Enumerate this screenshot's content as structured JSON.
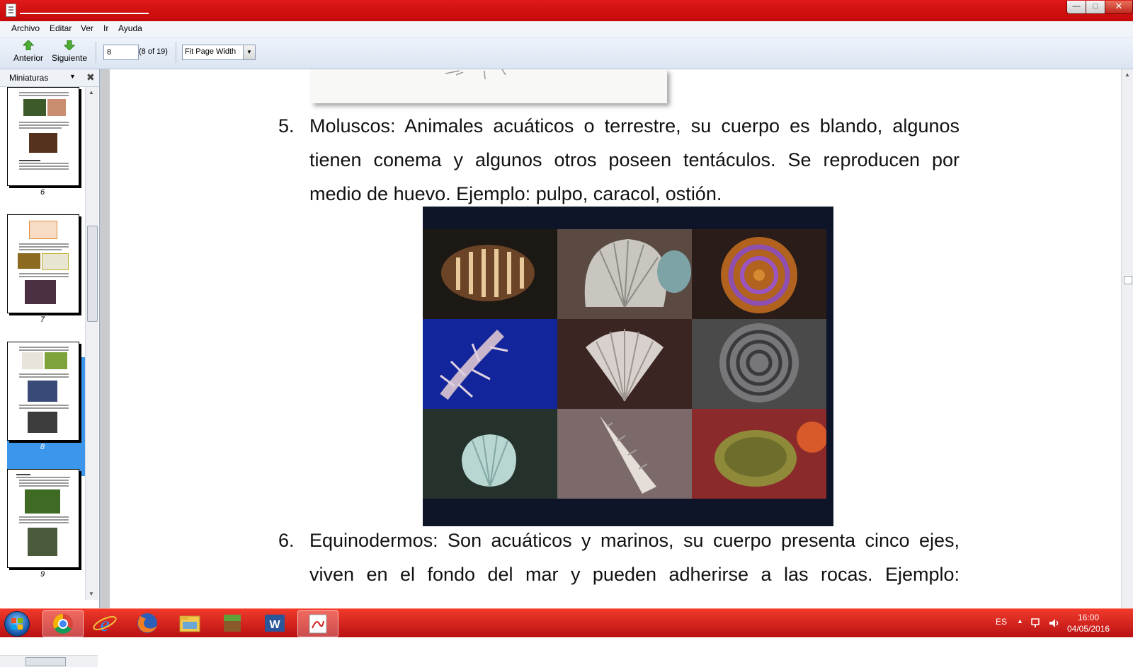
{
  "window": {
    "title": "",
    "min": "—",
    "max": "□",
    "close": "✕"
  },
  "menu": [
    "Archivo",
    "Editar",
    "Ver",
    "Ir",
    "Ayuda"
  ],
  "toolbar": {
    "prev_label": "Anterior",
    "next_label": "Siguiente",
    "page_value": "8",
    "page_count": "(8 of 19)",
    "zoom_value": "Fit Page Width",
    "zoom_dropdown_icon": "▼"
  },
  "sidebar": {
    "title": "Miniaturas",
    "dropdown_icon": "▼",
    "close_icon": "✖",
    "thumbnails": [
      {
        "label": "6"
      },
      {
        "label": "7"
      },
      {
        "label": "8",
        "selected": true
      },
      {
        "label": "9"
      }
    ]
  },
  "document": {
    "items": [
      {
        "number": "5.",
        "lines": [
          "Moluscos: Animales acuáticos o terrestre, su cuerpo es blando, algunos",
          "tienen conema y algunos otros poseen tentáculos. Se reproducen por",
          "medio de huevo. Ejemplo: pulpo, caracol, ostión."
        ]
      },
      {
        "number": "6.",
        "lines": [
          "Equinodermos: Son acuáticos y marinos, su cuerpo presenta cinco ejes,",
          "viven en el fondo del mar y pueden adherirse a las rocas. Ejemplo:"
        ]
      }
    ]
  },
  "taskbar": {
    "apps": [
      "chrome-icon",
      "internet-explorer-icon",
      "firefox-icon",
      "file-explorer-icon",
      "minecraft-icon",
      "word-icon",
      "pdf-reader-icon"
    ],
    "language": "ES",
    "tray_up_icon": "▲",
    "time": "16:00",
    "date": "04/05/2016"
  },
  "colors": {
    "titlebar": "#c40909",
    "taskbar": "#d0201a",
    "selection": "#3b96ec"
  }
}
